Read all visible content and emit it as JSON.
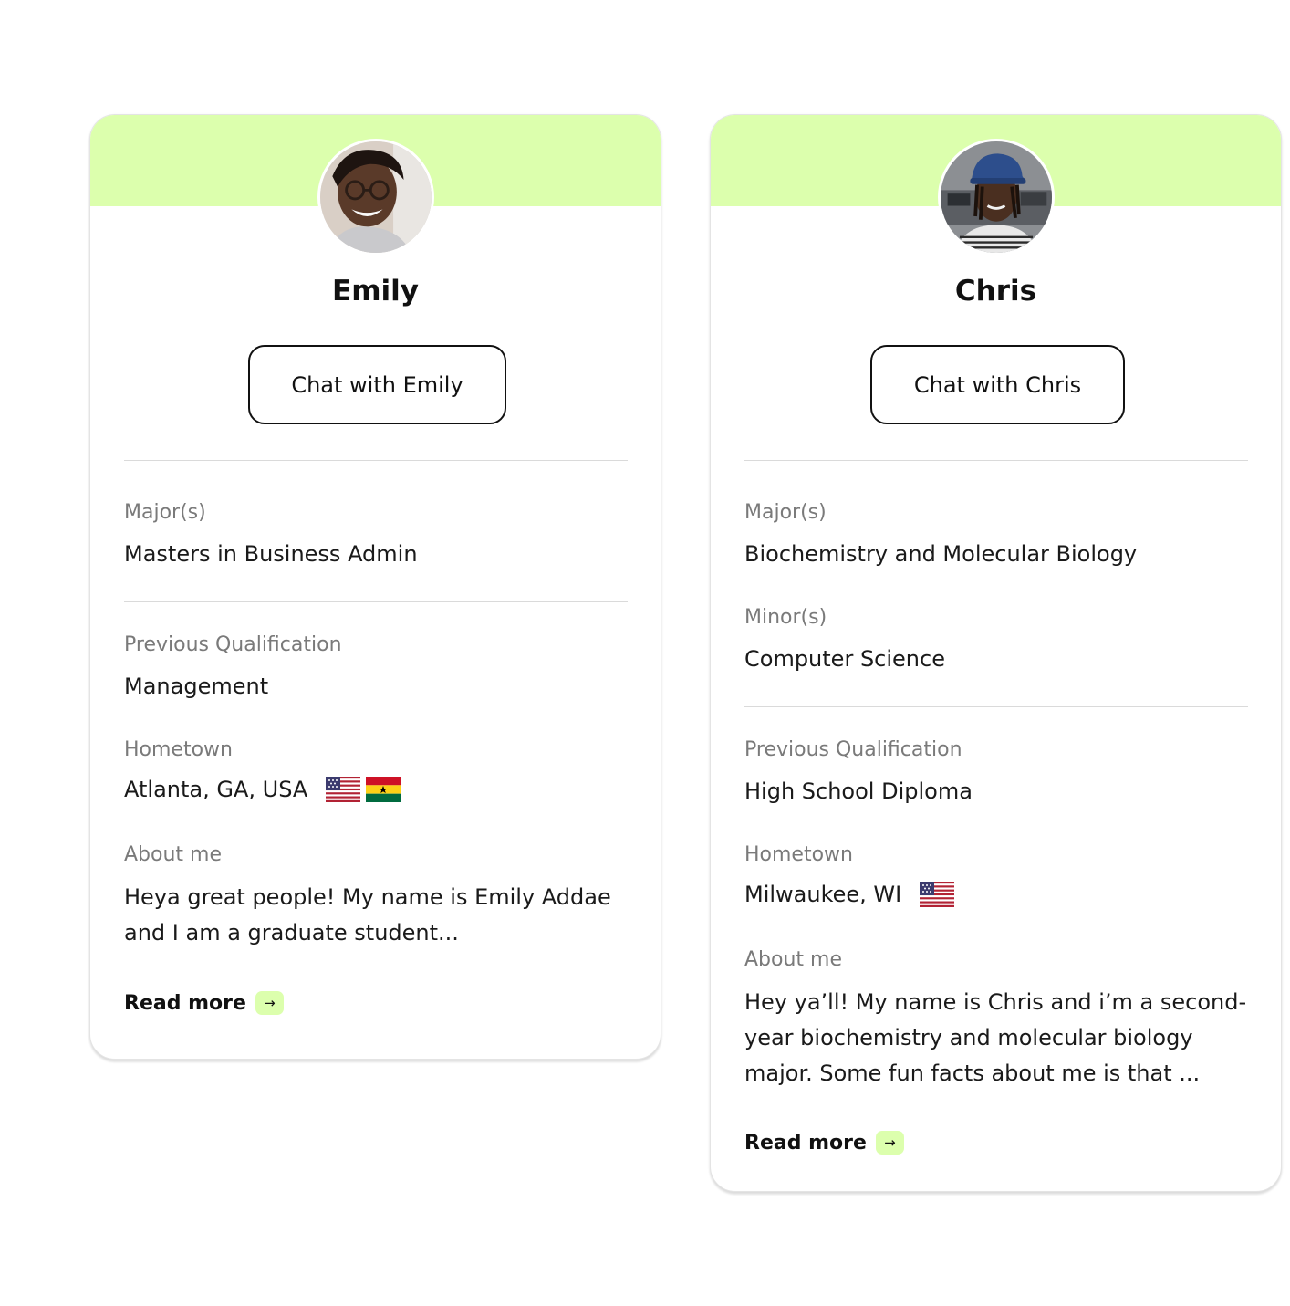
{
  "cards": [
    {
      "name": "Emily",
      "chat_button": "Chat with Emily",
      "major_label": "Major(s)",
      "major_value": "Masters in Business Admin",
      "prev_qual_label": "Previous Qualification",
      "prev_qual_value": "Management",
      "hometown_label": "Hometown",
      "hometown_value": "Atlanta, GA, USA",
      "hometown_flags": [
        "usa-flag-icon",
        "ghana-flag-icon"
      ],
      "about_label": "About me",
      "about_value": "Heya great people! My name is Emily Addae and I am a graduate student...",
      "read_more": "Read more"
    },
    {
      "name": "Chris",
      "chat_button": "Chat with Chris",
      "major_label": "Major(s)",
      "major_value": "Biochemistry and Molecular Biology",
      "minor_label": "Minor(s)",
      "minor_value": "Computer Science",
      "prev_qual_label": "Previous Qualification",
      "prev_qual_value": "High School Diploma",
      "hometown_label": "Hometown",
      "hometown_value": "Milwaukee, WI",
      "hometown_flags": [
        "usa-flag-icon"
      ],
      "about_label": "About me",
      "about_value": "Hey ya’ll! My name is Chris and i’m a second-year biochemistry and molecular biology major. Some fun facts about me is that ...",
      "read_more": "Read more"
    }
  ],
  "colors": {
    "banner": "#dcffad",
    "border": "#e4e4e4",
    "label": "#7a7a7a",
    "text": "#1a1a1a"
  },
  "icons": {
    "read_more_arrow": "arrow-right-icon"
  }
}
